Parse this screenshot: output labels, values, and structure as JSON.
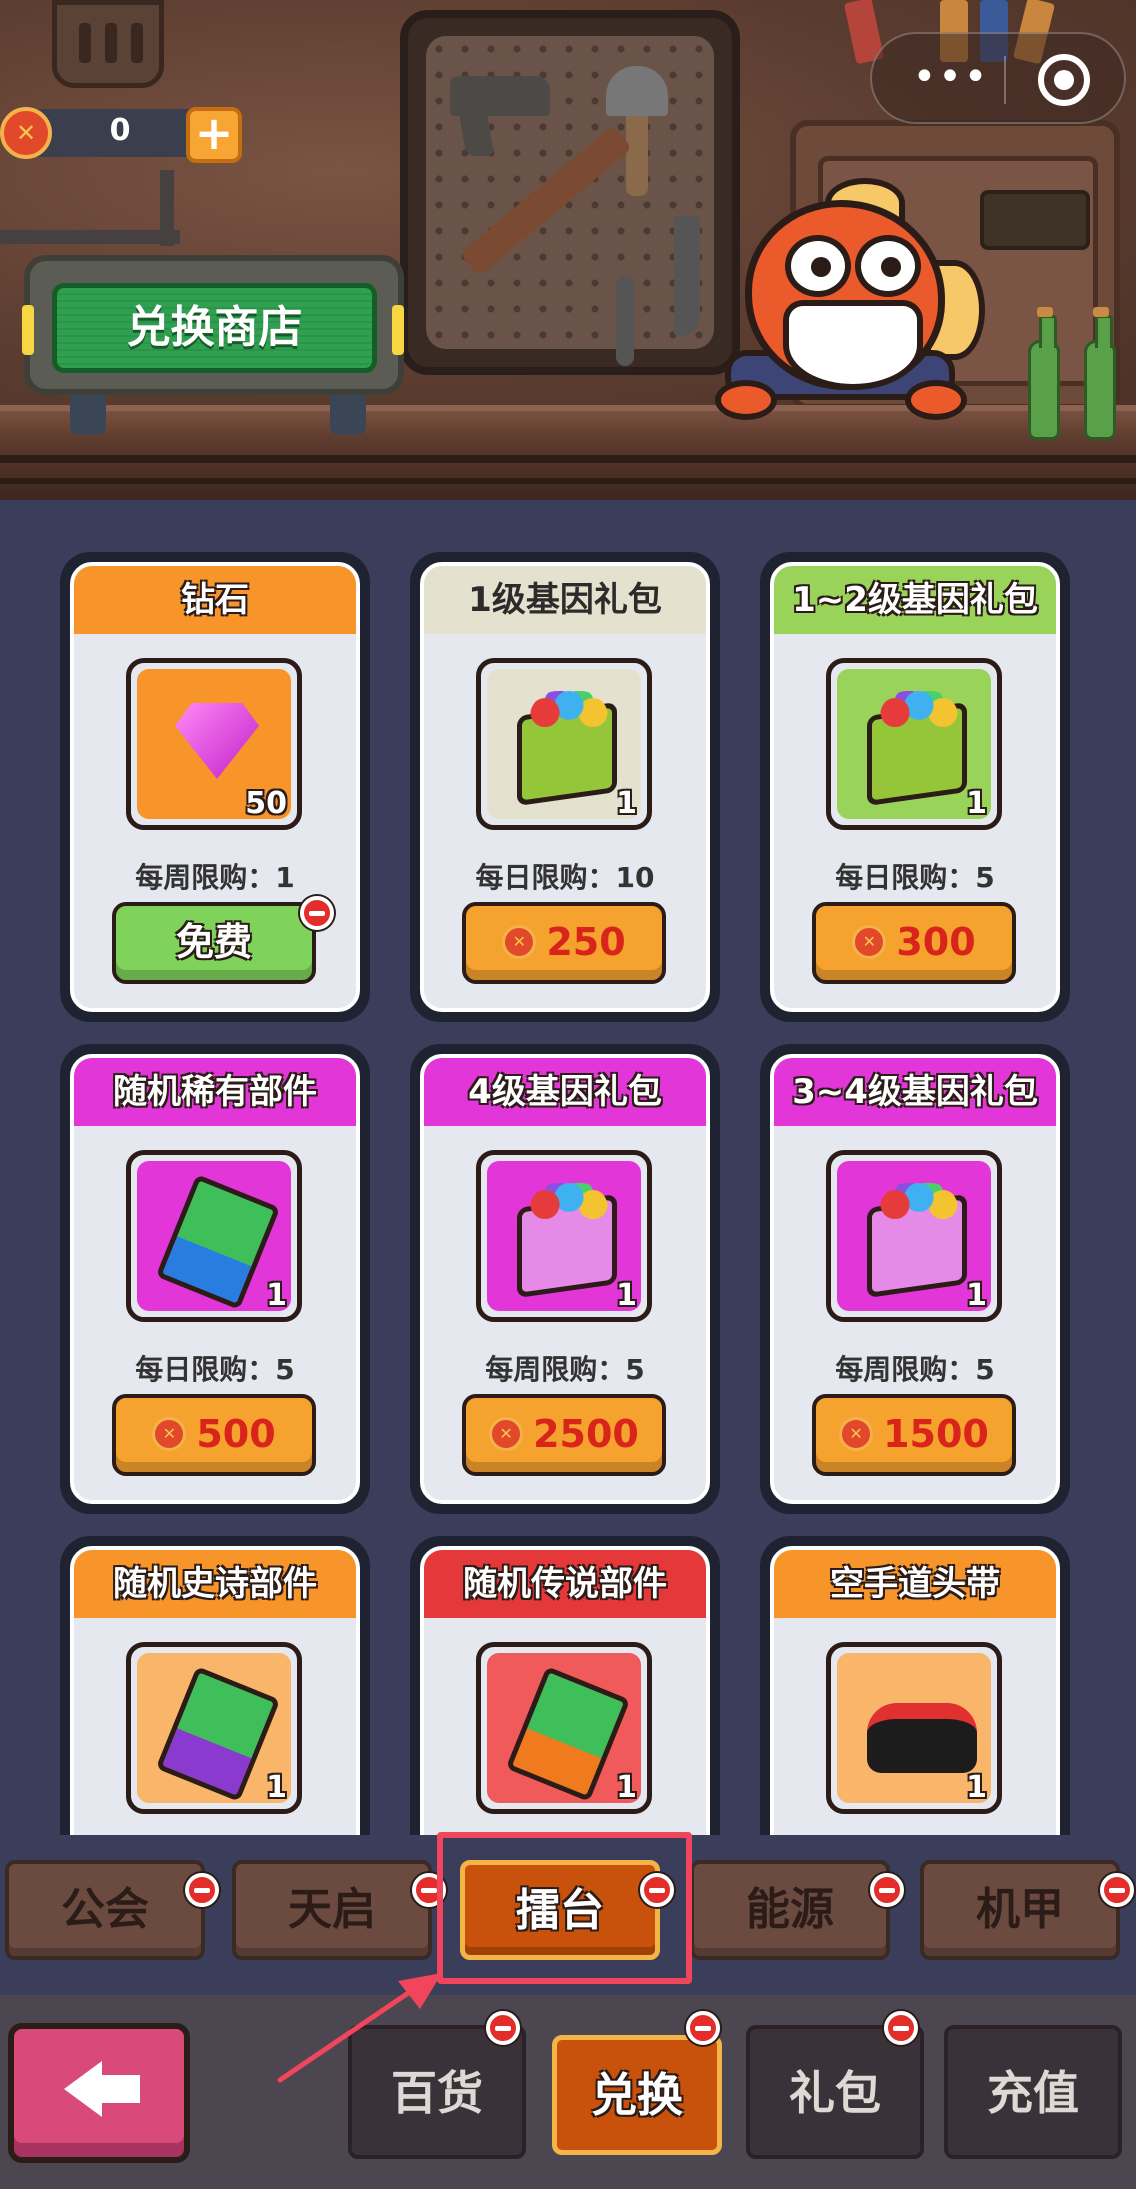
{
  "currency": {
    "value": "0",
    "add_label": "+"
  },
  "shop_title": "兑换商店",
  "capsule": {
    "more_label": "•••",
    "close_label": ""
  },
  "items": [
    {
      "title": "钻石",
      "quantity": "50",
      "limit": "每周限购：1",
      "button": "免费",
      "button_type": "free",
      "header_color": "#f7952a",
      "title_style": "light",
      "icon_bg": "#f7952a",
      "art": "gem",
      "has_dot": true
    },
    {
      "title": "1级基因礼包",
      "quantity": "1",
      "limit": "每日限购：10",
      "button": "250",
      "button_type": "price",
      "header_color": "#e4e1cf",
      "title_style": "dark",
      "icon_bg": "#e4e1cf",
      "art": "box-green",
      "has_dot": false
    },
    {
      "title": "1~2级基因礼包",
      "quantity": "1",
      "limit": "每日限购：5",
      "button": "300",
      "button_type": "price",
      "header_color": "#9ad35a",
      "title_style": "light",
      "icon_bg": "#9ad35a",
      "art": "box-green",
      "has_dot": false
    },
    {
      "title": "随机稀有部件",
      "quantity": "1",
      "limit": "每日限购：5",
      "button": "500",
      "button_type": "price",
      "header_color": "#e236d8",
      "title_style": "light",
      "icon_bg": "#e236d8",
      "art": "part-blue",
      "has_dot": false
    },
    {
      "title": "4级基因礼包",
      "quantity": "1",
      "limit": "每周限购：5",
      "button": "2500",
      "button_type": "price",
      "header_color": "#e236d8",
      "title_style": "light",
      "icon_bg": "#e236d8",
      "art": "box-pink",
      "has_dot": false
    },
    {
      "title": "3~4级基因礼包",
      "quantity": "1",
      "limit": "每周限购：5",
      "button": "1500",
      "button_type": "price",
      "header_color": "#e236d8",
      "title_style": "light",
      "icon_bg": "#e236d8",
      "art": "box-pink",
      "has_dot": false
    },
    {
      "title": "随机史诗部件",
      "quantity": "1",
      "limit": "",
      "button": "",
      "button_type": "price",
      "header_color": "#f7952a",
      "title_style": "light",
      "icon_bg": "#f9b56a",
      "art": "part-purple",
      "has_dot": false
    },
    {
      "title": "随机传说部件",
      "quantity": "1",
      "limit": "",
      "button": "",
      "button_type": "price",
      "header_color": "#e4383a",
      "title_style": "light",
      "icon_bg": "#f05a5a",
      "art": "part-orange",
      "has_dot": false
    },
    {
      "title": "空手道头带",
      "quantity": "1",
      "limit": "",
      "button": "",
      "button_type": "price",
      "header_color": "#f7952a",
      "title_style": "light",
      "icon_bg": "#f9b56a",
      "art": "headband",
      "has_dot": false
    }
  ],
  "category_tabs": [
    {
      "label": "公会",
      "active": false,
      "has_dot": true
    },
    {
      "label": "天启",
      "active": false,
      "has_dot": true
    },
    {
      "label": "擂台",
      "active": true,
      "has_dot": true
    },
    {
      "label": "能源",
      "active": false,
      "has_dot": true
    },
    {
      "label": "机甲",
      "active": false,
      "has_dot": true
    }
  ],
  "bottom_tabs": [
    {
      "label": "百货",
      "active": false,
      "has_dot": true
    },
    {
      "label": "兑换",
      "active": true,
      "has_dot": true
    },
    {
      "label": "礼包",
      "active": false,
      "has_dot": true
    },
    {
      "label": "充值",
      "active": false,
      "has_dot": false
    }
  ],
  "colors": {
    "accent_active": "#c8520c",
    "highlight_box": "#f0455a",
    "price_text": "#d8241b"
  }
}
